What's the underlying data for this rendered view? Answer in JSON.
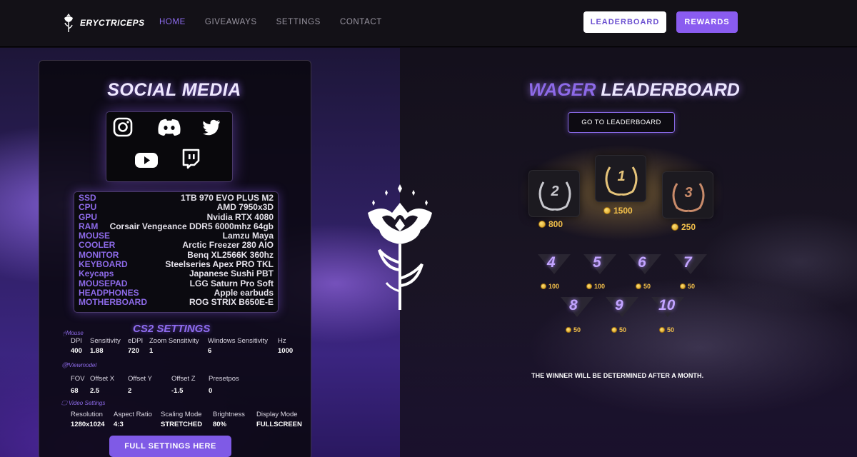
{
  "nav": {
    "logo_text": "ERYCTRICEPS",
    "links": [
      "HOME",
      "GIVEAWAYS",
      "SETTINGS",
      "CONTACT"
    ],
    "active": "HOME",
    "leaderboard_button": "LEADERBOARD",
    "rewards_button": "REWARDS"
  },
  "social": {
    "title": "SOCIAL MEDIA",
    "icons": [
      "instagram-icon",
      "discord-icon",
      "twitter-icon",
      "youtube-icon",
      "twitch-icon"
    ]
  },
  "specs": [
    {
      "k": "SSD",
      "v": "1TB 970 EVO PLUS M2"
    },
    {
      "k": "CPU",
      "v": "AMD 7950x3D"
    },
    {
      "k": "GPU",
      "v": "Nvidia RTX 4080"
    },
    {
      "k": "RAM",
      "v": "Corsair Vengeance DDR5 6000mhz 64gb"
    },
    {
      "k": "MOUSE",
      "v": "Lamzu Maya"
    },
    {
      "k": "COOLER",
      "v": "Arctic Freezer 280 AIO"
    },
    {
      "k": "MONITOR",
      "v": "Benq XL2566K 360hz"
    },
    {
      "k": "KEYBOARD",
      "v": "Steelseries Apex PRO TKL"
    },
    {
      "k": "Keycaps",
      "v": "Japanese Sushi PBT"
    },
    {
      "k": "MOUSEPAD",
      "v": "LGG Saturn Pro Soft"
    },
    {
      "k": "HEADPHONES",
      "v": "Apple earbuds"
    },
    {
      "k": "MOTHERBOARD",
      "v": "ROG STRIX B650E-E"
    }
  ],
  "cs2": {
    "title": "CS2 SETTINGS",
    "mouse_label": "Mouse",
    "mouse": {
      "headers": [
        "DPI",
        "Sensitivity",
        "eDPI",
        "Zoom Sensitivity",
        "Windows Sensitivity",
        "Hz"
      ],
      "values": [
        "400",
        "1.88",
        "720",
        "1",
        "6",
        "1000"
      ]
    },
    "viewmodel_label": "Viewmodel",
    "viewmodel": {
      "headers": [
        "FOV",
        "Offset X",
        "Offset Y",
        "Offset Z",
        "Presetpos"
      ],
      "values": [
        "68",
        "2.5",
        "2",
        "-1.5",
        "0"
      ]
    },
    "video_label": "Video Settings",
    "video": {
      "headers": [
        "Resolution",
        "Aspect Ratio",
        "Scaling Mode",
        "Brightness",
        "Display Mode"
      ],
      "values": [
        "1280x1024",
        "4:3",
        "STRETCHED",
        "80%",
        "FULLSCREEN"
      ]
    },
    "full_button": "FULL SETTINGS HERE"
  },
  "leaderboard": {
    "title_part1": "WAGER",
    "title_part2": "LEADERBOARD",
    "go_button": "GO TO LEADERBOARD",
    "podium": [
      {
        "rank": "2",
        "prize": "800",
        "color": "#c9c9cf"
      },
      {
        "rank": "1",
        "prize": "1500",
        "color": "#e6c47a"
      },
      {
        "rank": "3",
        "prize": "250",
        "color": "#c98b6a"
      }
    ],
    "others": [
      {
        "rank": "4",
        "prize": "100"
      },
      {
        "rank": "5",
        "prize": "100"
      },
      {
        "rank": "6",
        "prize": "50"
      },
      {
        "rank": "7",
        "prize": "50"
      },
      {
        "rank": "8",
        "prize": "50"
      },
      {
        "rank": "9",
        "prize": "50"
      },
      {
        "rank": "10",
        "prize": "50"
      }
    ],
    "winner_note": "THE WINNER WILL BE DETERMINED AFTER A MONTH."
  },
  "colors": {
    "accent": "#8a5cf0",
    "gold": "#f3c04a",
    "rank_text": "#c2a4ff"
  }
}
